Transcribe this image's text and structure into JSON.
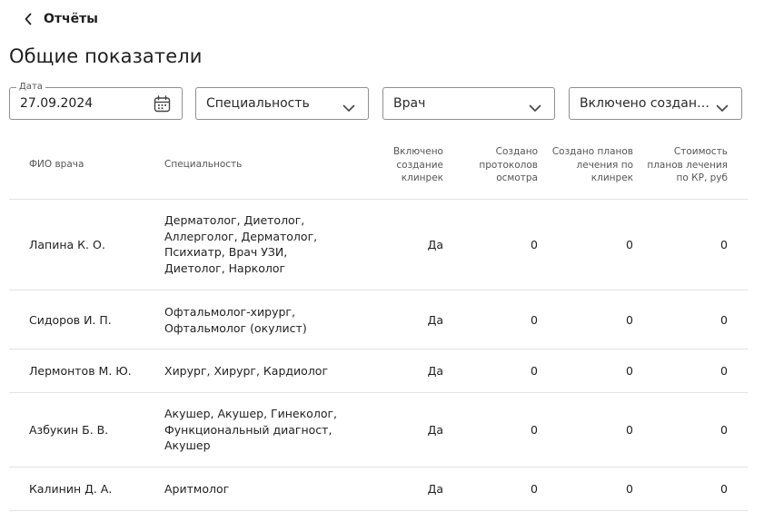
{
  "header": {
    "back_label": "Отчёты",
    "title": "Общие показатели"
  },
  "filters": {
    "date_label": "Дата",
    "date_value": "27.09.2024",
    "specialty": "Специальность",
    "doctor": "Врач",
    "clinrec": "Включено создани..."
  },
  "table": {
    "columns": {
      "name": "ФИО врача",
      "specialty": "Специальность",
      "clinrec": [
        "Включено",
        "создание",
        "клинрек"
      ],
      "protocols": [
        "Создано",
        "протоколов",
        "осмотра"
      ],
      "plans": [
        "Создано планов",
        "лечения по",
        "клинрек"
      ],
      "cost": [
        "Стоимость",
        "планов лечения",
        "по КР, руб"
      ]
    },
    "rows": [
      {
        "name": "Лапина К. О.",
        "specialty": "Дерматолог, Диетолог, Аллергolог, Дерматолог, Психиатр, Врач УЗИ, Диетолог, Нарколог",
        "clinrec": "Да",
        "protocols": "0",
        "plans": "0",
        "cost": "0"
      },
      {
        "name": "Сидоров И. П.",
        "specialty": "Офтальмолог-хирург, Офтальмолог (окулист)",
        "clinrec": "Да",
        "protocols": "0",
        "plans": "0",
        "cost": "0"
      },
      {
        "name": "Лермонтов М. Ю.",
        "specialty": "Хирург, Хирург, Кардиолог",
        "clinrec": "Да",
        "protocols": "0",
        "plans": "0",
        "cost": "0"
      },
      {
        "name": "Азбукин Б. В.",
        "specialty": "Акушер, Акушер, Гинеколог, Функциональный диагност, Акушер",
        "clinrec": "Да",
        "protocols": "0",
        "plans": "0",
        "cost": "0"
      },
      {
        "name": "Калинин Д. А.",
        "specialty": "Аритмолог",
        "clinrec": "Да",
        "protocols": "0",
        "plans": "0",
        "cost": "0"
      }
    ]
  }
}
